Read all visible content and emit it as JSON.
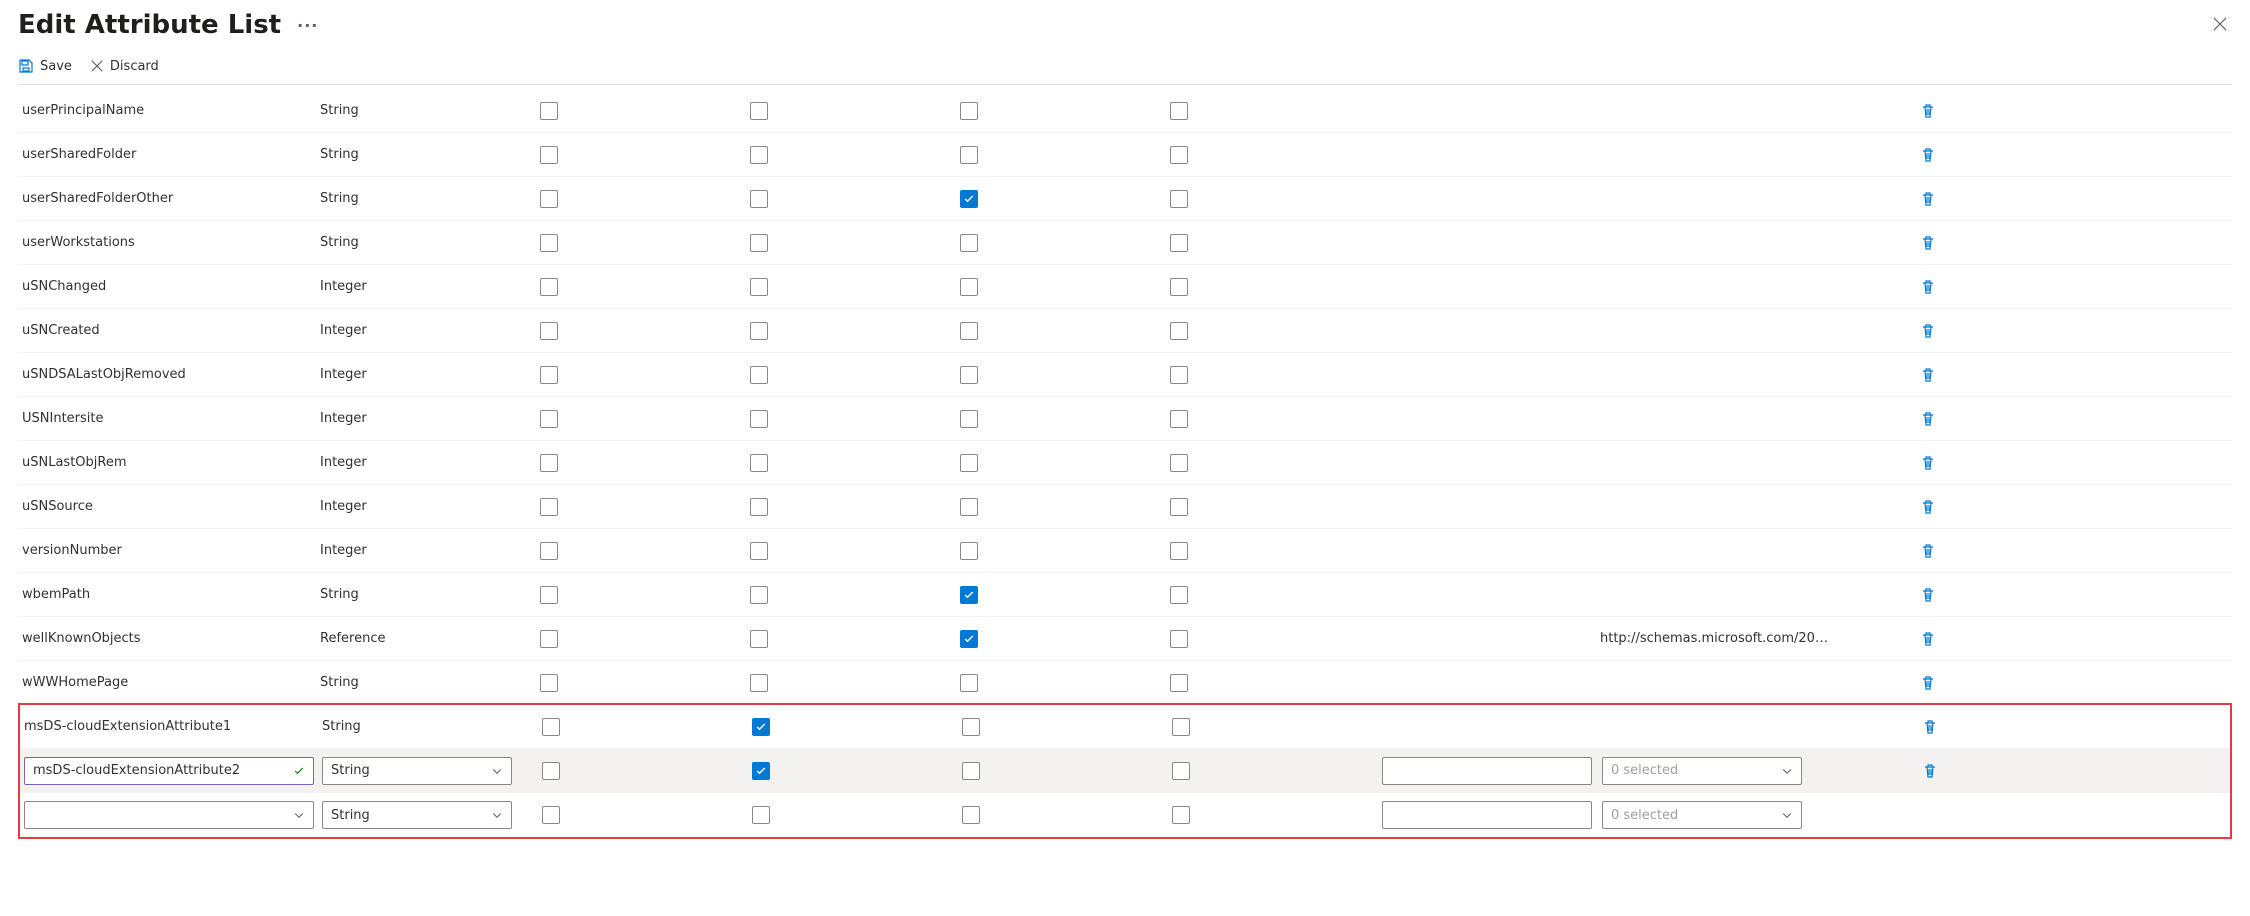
{
  "header": {
    "title": "Edit Attribute List",
    "more_label": "···"
  },
  "toolbar": {
    "save_label": "Save",
    "discard_label": "Discard"
  },
  "rows": [
    {
      "name": "userPrincipalName",
      "type": "String",
      "c1": false,
      "c2": false,
      "c3": false,
      "c4": false,
      "ref": ""
    },
    {
      "name": "userSharedFolder",
      "type": "String",
      "c1": false,
      "c2": false,
      "c3": false,
      "c4": false,
      "ref": ""
    },
    {
      "name": "userSharedFolderOther",
      "type": "String",
      "c1": false,
      "c2": false,
      "c3": true,
      "c4": false,
      "ref": ""
    },
    {
      "name": "userWorkstations",
      "type": "String",
      "c1": false,
      "c2": false,
      "c3": false,
      "c4": false,
      "ref": ""
    },
    {
      "name": "uSNChanged",
      "type": "Integer",
      "c1": false,
      "c2": false,
      "c3": false,
      "c4": false,
      "ref": ""
    },
    {
      "name": "uSNCreated",
      "type": "Integer",
      "c1": false,
      "c2": false,
      "c3": false,
      "c4": false,
      "ref": ""
    },
    {
      "name": "uSNDSALastObjRemoved",
      "type": "Integer",
      "c1": false,
      "c2": false,
      "c3": false,
      "c4": false,
      "ref": ""
    },
    {
      "name": "USNIntersite",
      "type": "Integer",
      "c1": false,
      "c2": false,
      "c3": false,
      "c4": false,
      "ref": ""
    },
    {
      "name": "uSNLastObjRem",
      "type": "Integer",
      "c1": false,
      "c2": false,
      "c3": false,
      "c4": false,
      "ref": ""
    },
    {
      "name": "uSNSource",
      "type": "Integer",
      "c1": false,
      "c2": false,
      "c3": false,
      "c4": false,
      "ref": ""
    },
    {
      "name": "versionNumber",
      "type": "Integer",
      "c1": false,
      "c2": false,
      "c3": false,
      "c4": false,
      "ref": ""
    },
    {
      "name": "wbemPath",
      "type": "String",
      "c1": false,
      "c2": false,
      "c3": true,
      "c4": false,
      "ref": ""
    },
    {
      "name": "wellKnownObjects",
      "type": "Reference",
      "c1": false,
      "c2": false,
      "c3": true,
      "c4": false,
      "ref": "http://schemas.microsoft.com/20…"
    },
    {
      "name": "wWWHomePage",
      "type": "String",
      "c1": false,
      "c2": false,
      "c3": false,
      "c4": false,
      "ref": ""
    }
  ],
  "edit_rows": {
    "row_a": {
      "name": "msDS-cloudExtensionAttribute1",
      "type": "String",
      "c1": false,
      "c2": true,
      "c3": false,
      "c4": false
    },
    "row_b": {
      "name": "msDS-cloudExtensionAttribute2",
      "type": "String",
      "c1": false,
      "c2": true,
      "c3": false,
      "c4": false,
      "ref_placeholder": "0 selected"
    },
    "row_c": {
      "name": "",
      "type": "String",
      "ref_placeholder": "0 selected"
    }
  }
}
